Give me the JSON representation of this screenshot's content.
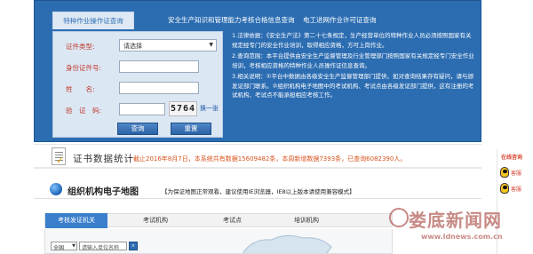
{
  "tabs": [
    {
      "label": "特种作业操作证查询",
      "active": true
    },
    {
      "label": "安全生产知识和管理能力考核合格信息查询",
      "active": false
    },
    {
      "label": "电工进网作业许可证查询",
      "active": false
    }
  ],
  "form": {
    "cert_type_label": "证件类型:",
    "cert_type_value": "请选择",
    "id_label": "身份证件号:",
    "name_label": "姓　　名:",
    "captcha_label": "验　证　码:",
    "captcha_code": "5764",
    "refresh_label": "换一张",
    "query_button": "查询",
    "reset_button": "重置"
  },
  "notes": [
    "1.法律依据：《安全生产法》第二十七条规定，生产经营单位的特种作业人员必须按照国家有关规定经专门的安全作业培训，取得相应资格，方可上岗作业。",
    "2.查询范围：本平台提供由安全生产监督管理及行业管理部门按照国家有关规定经专门安全作业培训，考核相应资格的特种作业人员操作证信息查询。",
    "3.相关说明：①平台中数据由各级安全生产监督管理部门提供，如对查询结果存有疑问，请与颁发证部门联系。②组织机构电子地图中的考试机构、考试点由各级发证部门提供，这有注册的考试机构、考试点不能承担相应考核工作。"
  ],
  "stats": {
    "title": "证书数据统计",
    "text": "截止2016年8月7日，本系统共有数据15609482条，本周新增数据7393条，已查询6082390人。"
  },
  "map": {
    "title": "组织机构电子地图",
    "note": "【为保证地图正常观看，建议使用IE浏览器，IE8以上版本请使用兼容模式】",
    "tabs": [
      {
        "label": "考核发证机关",
        "active": true
      },
      {
        "label": "考试机构",
        "active": false
      },
      {
        "label": "考试点",
        "active": false
      },
      {
        "label": "培训机构",
        "active": false
      }
    ],
    "region_value": "全国",
    "unit_placeholder": "请输入单位名称"
  },
  "sidebar": {
    "title": "在线咨询",
    "items": [
      {
        "label": "客服",
        "icon": "qq-icon"
      },
      {
        "label": "客服",
        "icon": "qq-icon"
      }
    ]
  },
  "watermark": {
    "text": "娄底新闻网",
    "url": "www.ldnews.com.cn"
  },
  "colors": {
    "panel_blue": "#2c6db2",
    "stats_orange": "#d9531e",
    "label_red": "#c0392b"
  }
}
